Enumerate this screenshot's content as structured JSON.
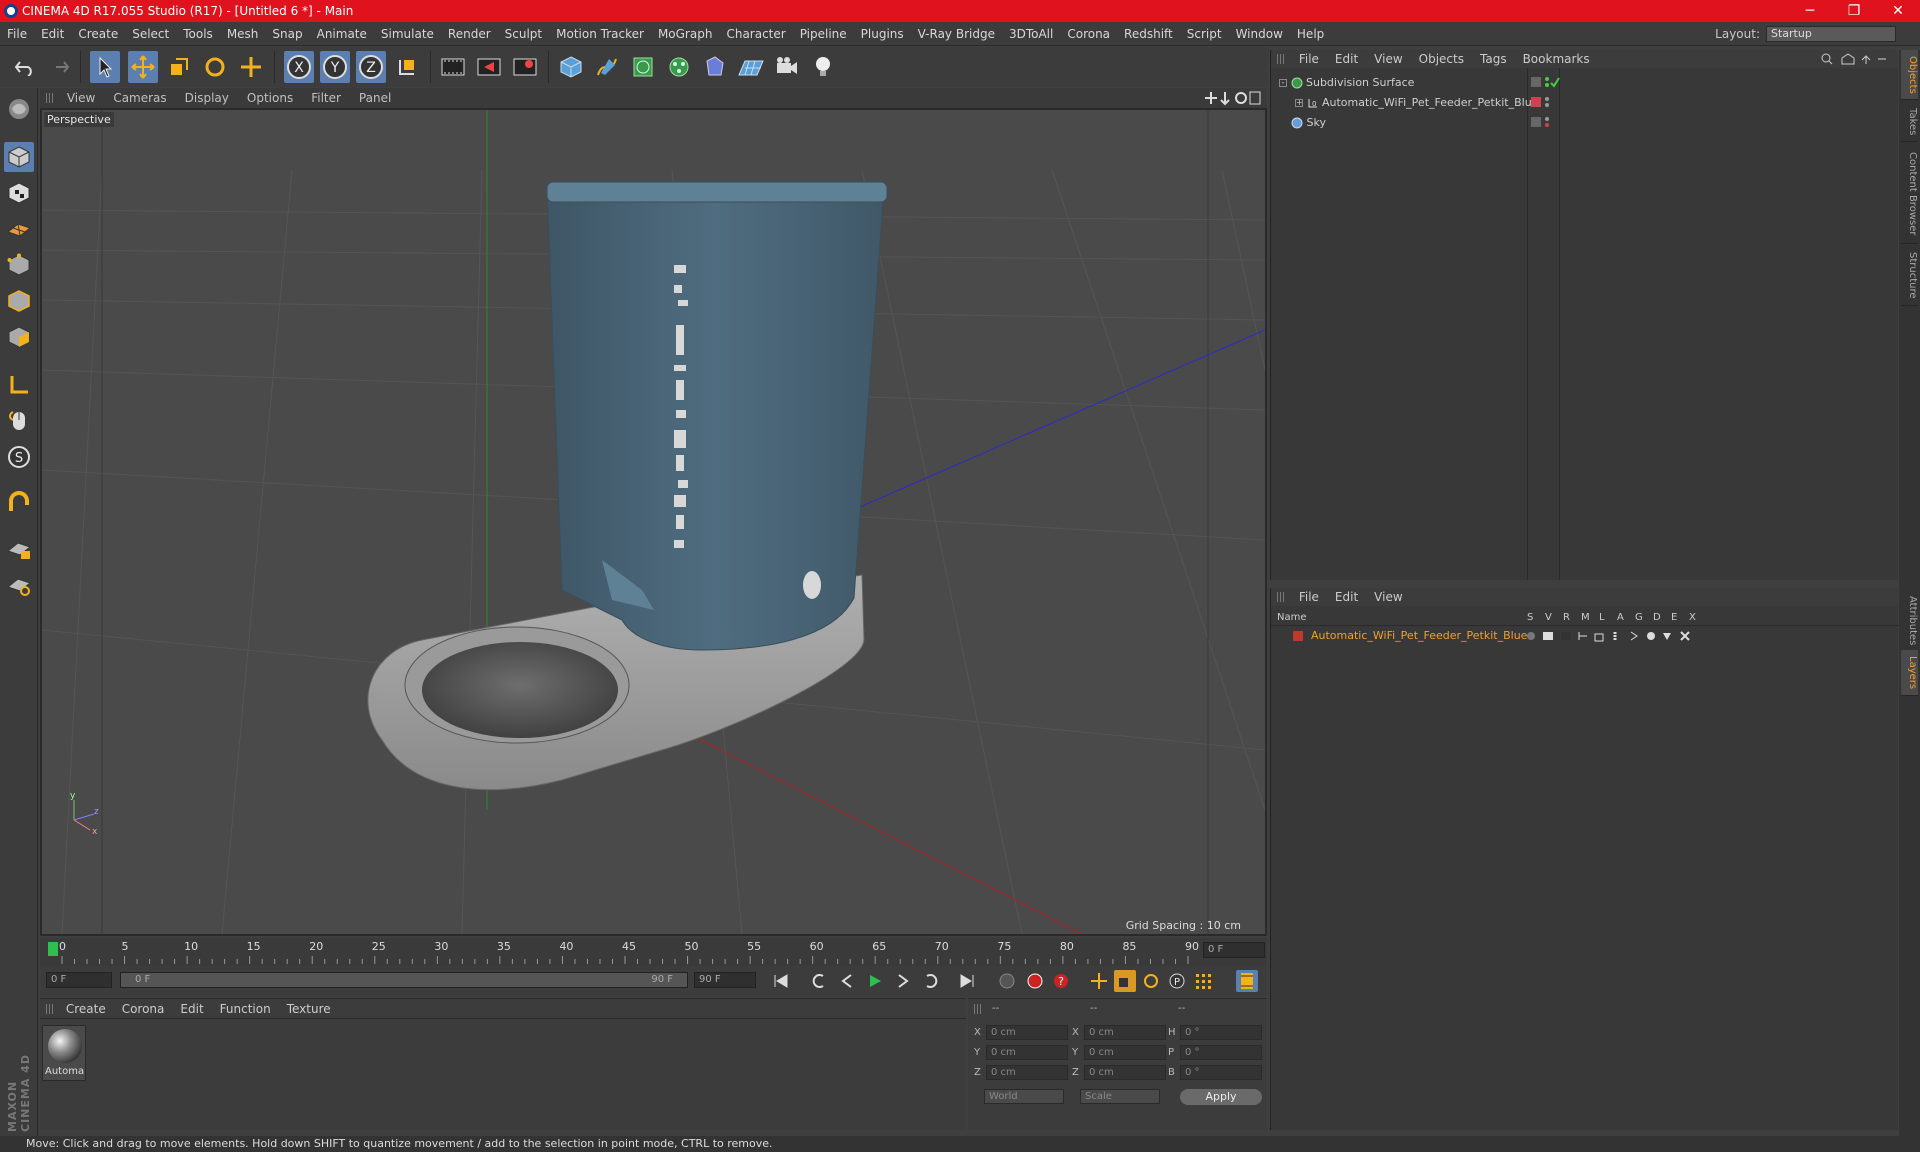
{
  "app": {
    "title": "CINEMA 4D R17.055 Studio (R17) - [Untitled 6 *] - Main",
    "minimize": "─",
    "maximize": "❐",
    "close": "✕"
  },
  "menu": [
    "File",
    "Edit",
    "Create",
    "Select",
    "Tools",
    "Mesh",
    "Snap",
    "Animate",
    "Simulate",
    "Render",
    "Sculpt",
    "Motion Tracker",
    "MoGraph",
    "Character",
    "Pipeline",
    "Plugins",
    "V-Ray Bridge",
    "3DToAll",
    "Corona",
    "Redshift",
    "Script",
    "Window",
    "Help"
  ],
  "layout": {
    "label": "Layout:",
    "value": "Startup"
  },
  "viewport": {
    "menu": [
      "View",
      "Cameras",
      "Display",
      "Options",
      "Filter",
      "Panel"
    ],
    "label": "Perspective",
    "grid_spacing": "Grid Spacing : 10 cm"
  },
  "timeline": {
    "ticks": [
      "0",
      "5",
      "10",
      "15",
      "20",
      "25",
      "30",
      "35",
      "40",
      "45",
      "50",
      "55",
      "60",
      "65",
      "70",
      "75",
      "80",
      "85",
      "90"
    ],
    "frame_field": "0 F",
    "start_field": "0 F",
    "slider_start": "0 F",
    "slider_end": "90 F",
    "end_field": "90 F"
  },
  "material_panel": {
    "menu": [
      "Create",
      "Corona",
      "Edit",
      "Function",
      "Texture"
    ],
    "material_name": "Automa"
  },
  "coords": {
    "header": [
      "--",
      "--",
      "--"
    ],
    "rows": [
      {
        "a": "X",
        "av": "0 cm",
        "b": "X",
        "bv": "0 cm",
        "c": "H",
        "cv": "0 °"
      },
      {
        "a": "Y",
        "av": "0 cm",
        "b": "Y",
        "bv": "0 cm",
        "c": "P",
        "cv": "0 °"
      },
      {
        "a": "Z",
        "av": "0 cm",
        "b": "Z",
        "bv": "0 cm",
        "c": "B",
        "cv": "0 °"
      }
    ],
    "world": "World",
    "scale": "Scale",
    "apply": "Apply"
  },
  "object_manager": {
    "menu": [
      "File",
      "Edit",
      "View",
      "Objects",
      "Tags",
      "Bookmarks"
    ],
    "objects": [
      "Subdivision Surface",
      "Automatic_WiFi_Pet_Feeder_Petkit_Blue",
      "Sky"
    ]
  },
  "layer_manager": {
    "menu": [
      "File",
      "Edit",
      "View"
    ],
    "columns": [
      "Name",
      "S",
      "V",
      "R",
      "M",
      "L",
      "A",
      "G",
      "D",
      "E",
      "X"
    ],
    "layer": "Automatic_WiFi_Pet_Feeder_Petkit_Blue"
  },
  "side_tabs": [
    "Objects",
    "Takes",
    "Content Browser",
    "Structure",
    "Attributes",
    "Layers"
  ],
  "brand": "MAXON CINEMA 4D",
  "status": "Move: Click and drag to move elements. Hold down SHIFT to quantize movement / add to the selection in point mode, CTRL to remove.",
  "colors": {
    "titlebar": "#e0121e",
    "accent": "#f0a030",
    "layer_color": "#c0392b"
  }
}
